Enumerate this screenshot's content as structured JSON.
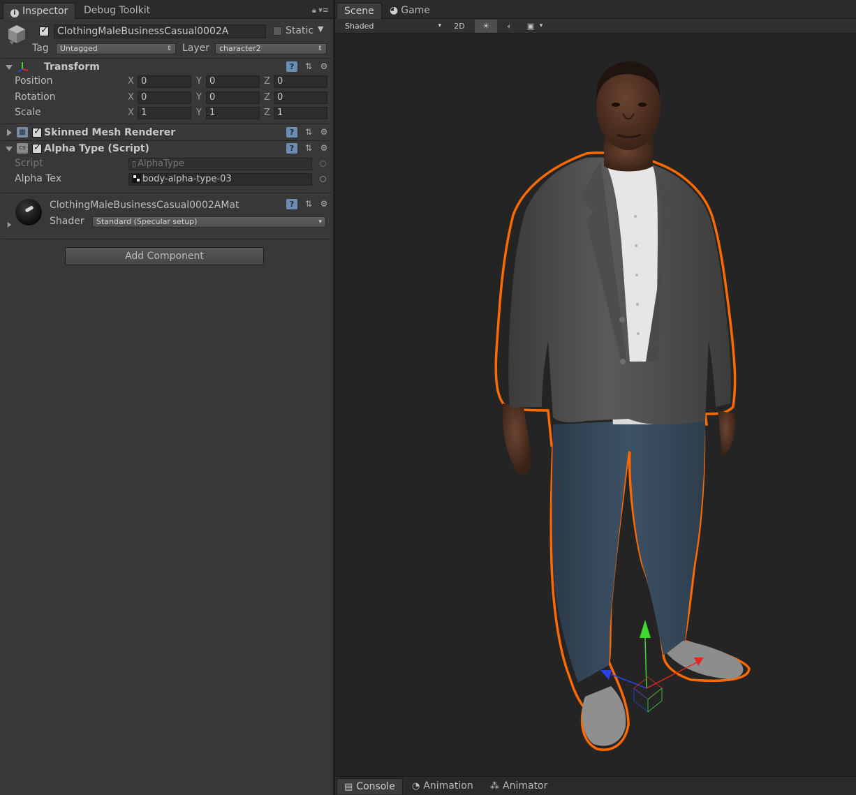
{
  "inspector": {
    "tabs": [
      {
        "label": "Inspector",
        "active": true
      },
      {
        "label": "Debug Toolkit",
        "active": false
      }
    ],
    "object": {
      "active": true,
      "name": "ClothingMaleBusinessCasual0002A",
      "static_label": "Static",
      "static": false,
      "tag_label": "Tag",
      "tag_value": "Untagged",
      "layer_label": "Layer",
      "layer_value": "character2"
    },
    "transform": {
      "title": "Transform",
      "rows": [
        {
          "label": "Position",
          "x": "0",
          "y": "0",
          "z": "0"
        },
        {
          "label": "Rotation",
          "x": "0",
          "y": "0",
          "z": "0"
        },
        {
          "label": "Scale",
          "x": "1",
          "y": "1",
          "z": "1"
        }
      ],
      "axis_x": "X",
      "axis_y": "Y",
      "axis_z": "Z"
    },
    "skinned_mesh": {
      "title": "Skinned Mesh Renderer",
      "enabled": true
    },
    "alpha_type": {
      "title": "Alpha Type (Script)",
      "enabled": true,
      "script_label": "Script",
      "script_value": "AlphaType",
      "alpha_tex_label": "Alpha Tex",
      "alpha_tex_value": "body-alpha-type-03"
    },
    "material": {
      "name": "ClothingMaleBusinessCasual0002AMat",
      "shader_label": "Shader",
      "shader_value": "Standard (Specular setup)"
    },
    "add_component_label": "Add Component"
  },
  "scene": {
    "tabs": [
      {
        "label": "Scene",
        "active": true
      },
      {
        "label": "Game",
        "active": false
      }
    ],
    "toolbar": {
      "draw_mode": "Shaded",
      "mode_2d": "2D"
    }
  },
  "bottom_tabs": [
    {
      "label": "Console",
      "active": true
    },
    {
      "label": "Animation",
      "active": false
    },
    {
      "label": "Animator",
      "active": false
    }
  ],
  "colors": {
    "selection_outline": "#ff6a00",
    "gizmo_y": "#3fd92f",
    "gizmo_x": "#e0281e",
    "gizmo_z": "#2b43e6"
  }
}
